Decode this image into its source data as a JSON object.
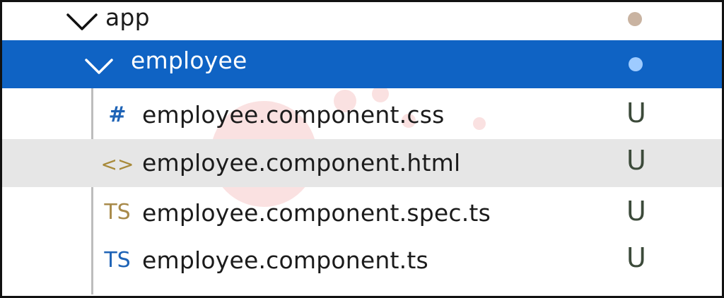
{
  "explorer": {
    "folders": {
      "app": {
        "label": "app",
        "dot_color": "#c9b3a1"
      },
      "employee": {
        "label": "employee",
        "dot_color": "#9ecbff",
        "highlight_color": "#0f63c4"
      }
    },
    "files": [
      {
        "icon": "#",
        "icon_name": "css-hash-icon",
        "name": "employee.component.css",
        "status": "U"
      },
      {
        "icon": "<>",
        "icon_name": "html-code-icon",
        "name": "employee.component.html",
        "status": "U"
      },
      {
        "icon": "TS",
        "icon_name": "ts-spec-icon",
        "name": "employee.component.spec.ts",
        "status": "U"
      },
      {
        "icon": "TS",
        "icon_name": "ts-icon",
        "name": "employee.component.ts",
        "status": "U"
      }
    ],
    "colors": {
      "status_u": "#3c4a3a",
      "tree_guide": "#bdbdbd",
      "hover_row": "#e6e6e6"
    }
  }
}
